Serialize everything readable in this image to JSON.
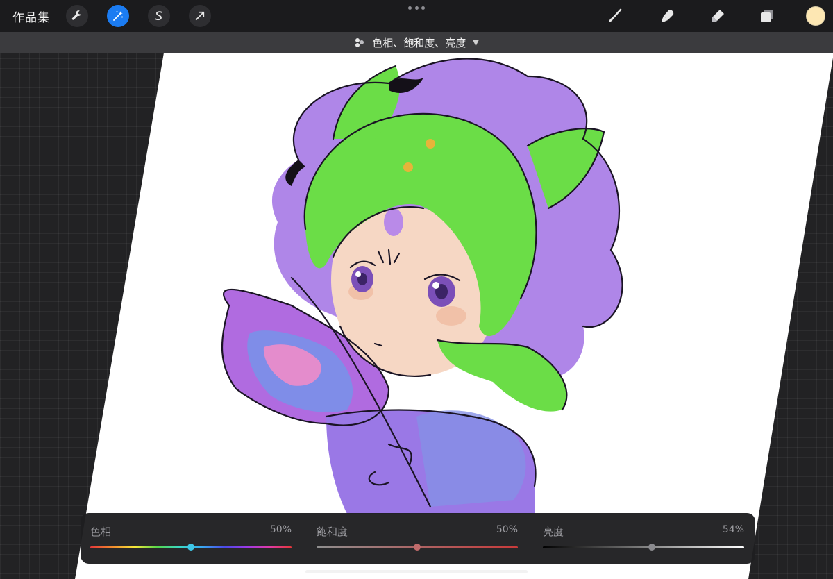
{
  "topbar": {
    "gallery_label": "作品集",
    "swatch_color": "#fde7b3",
    "accent_color": "#1b7cf2",
    "tools_left": [
      "wrench-icon",
      "magic-wand-icon",
      "selection-s-icon",
      "arrow-cursor-icon"
    ],
    "tools_right": [
      "brush-icon",
      "smudge-icon",
      "eraser-icon",
      "layers-icon"
    ]
  },
  "adjustment": {
    "title": "色相、飽和度、亮度",
    "icon": "adjustments-icon"
  },
  "sliders": [
    {
      "label": "色相",
      "value_text": "50%",
      "value": 0.5,
      "knob_color": "#3ec7e6"
    },
    {
      "label": "飽和度",
      "value_text": "50%",
      "value": 0.5,
      "knob_color": "#c06b6b"
    },
    {
      "label": "亮度",
      "value_text": "54%",
      "value": 0.54,
      "knob_color": "#8a8a8e"
    }
  ]
}
